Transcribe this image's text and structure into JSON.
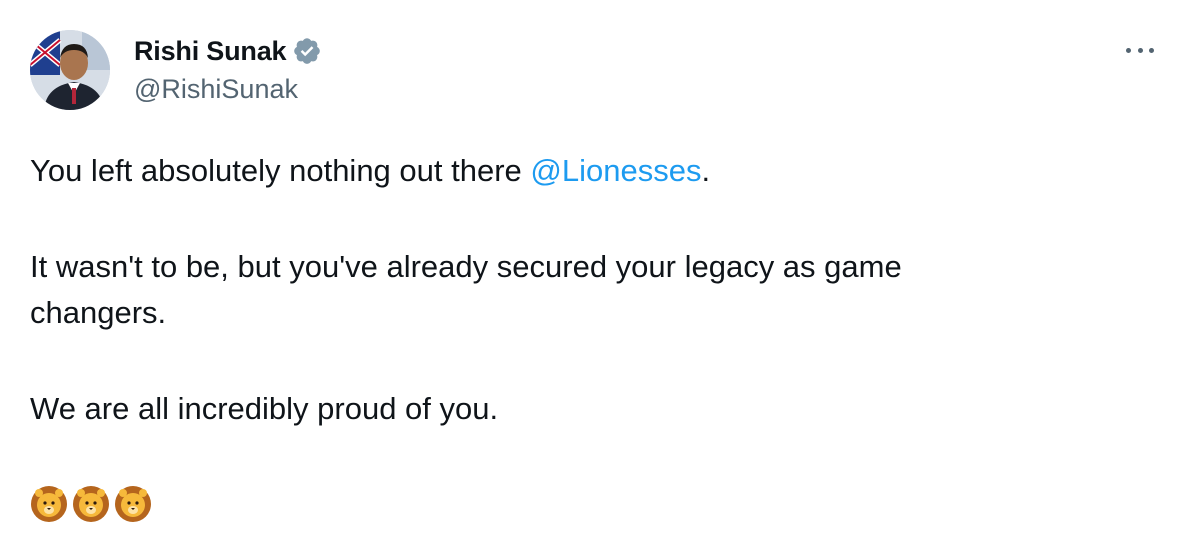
{
  "author": {
    "display_name": "Rishi Sunak",
    "handle": "@RishiSunak",
    "verified": true,
    "verified_color": "#829aab"
  },
  "tweet": {
    "line1_prefix": "You left absolutely nothing out there ",
    "line1_mention": "@Lionesses",
    "line1_suffix": ".",
    "line2": "It wasn't to be, but you've already secured your legacy as game changers.",
    "line3": "We are all incredibly proud of you.",
    "emojis": [
      "lion-face-icon",
      "lion-face-icon",
      "lion-face-icon"
    ]
  },
  "colors": {
    "text": "#0f1419",
    "secondary": "#536471",
    "link": "#1d9bf0"
  },
  "icons": {
    "more": "more-options-icon",
    "verified": "verified-badge-icon"
  }
}
